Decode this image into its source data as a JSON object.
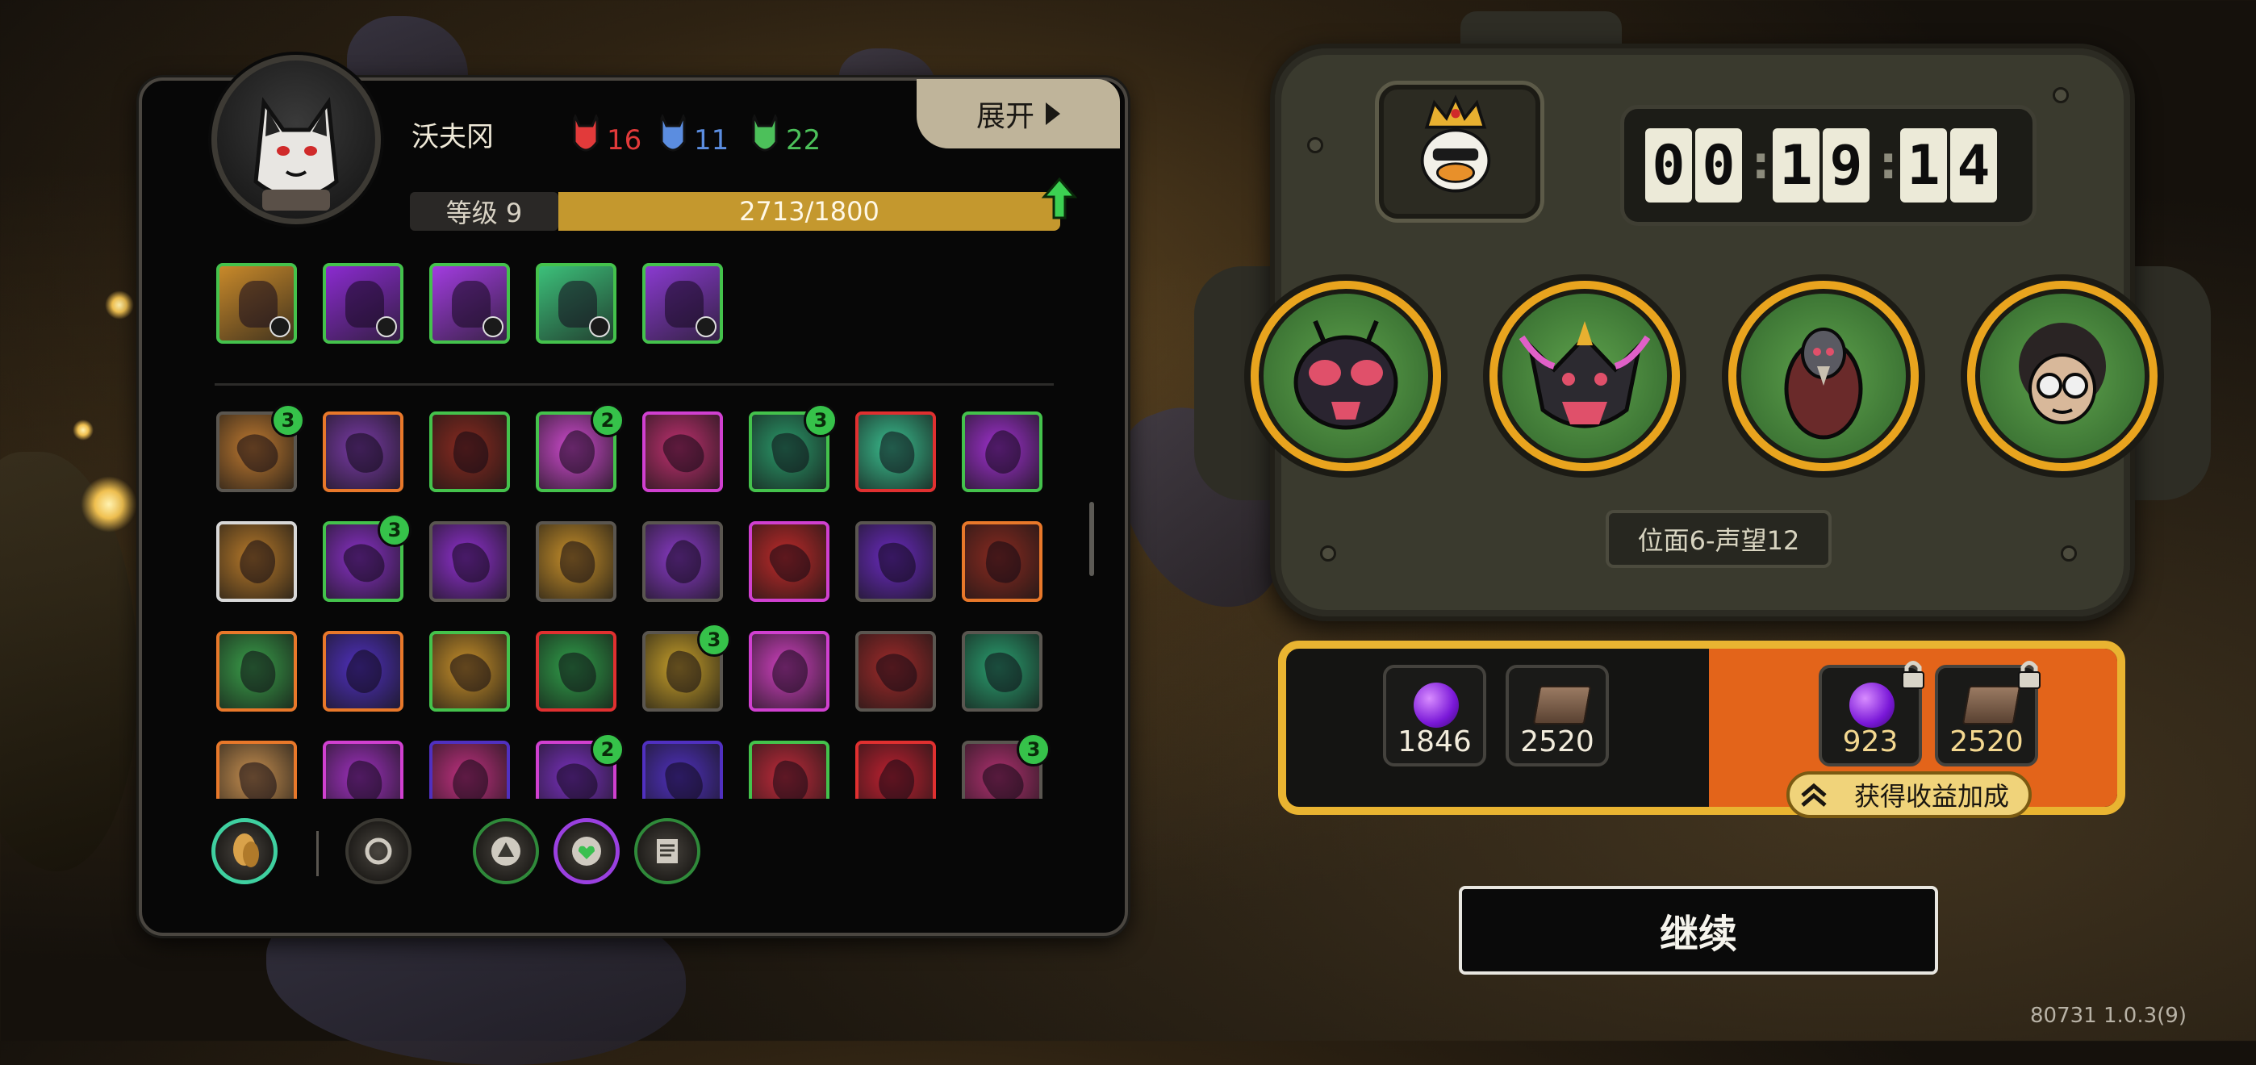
{
  "player": {
    "name": "沃夫冈",
    "level_label": "等级 9",
    "xp_text": "2713/1800",
    "stats": [
      {
        "icon": "red-mask-icon",
        "value": "16",
        "color": "#e23a3a"
      },
      {
        "icon": "blue-mask-icon",
        "value": "11",
        "color": "#5b8de0"
      },
      {
        "icon": "green-mask-icon",
        "value": "22",
        "color": "#4cc05a"
      }
    ]
  },
  "expand_label": "展开",
  "timer": {
    "h1": "0",
    "h2": "0",
    "m1": "1",
    "m2": "9",
    "s1": "1",
    "s2": "4"
  },
  "plane_label": "位面6-声望12",
  "rewards": {
    "left": [
      {
        "icon": "purple-orb-icon",
        "value": "1846"
      },
      {
        "icon": "tome-icon",
        "value": "2520"
      }
    ],
    "right": [
      {
        "icon": "purple-orb-icon",
        "value": "923"
      },
      {
        "icon": "tome-icon",
        "value": "2520"
      }
    ],
    "bonus_label": "获得收益加成"
  },
  "continue_label": "继续",
  "version": "80731 1.0.3(9)",
  "equipped_skills": [
    {
      "color": "#c8892a",
      "border": "#44c24c"
    },
    {
      "color": "#8b2bd0",
      "border": "#44c24c"
    },
    {
      "color": "#a23ce0",
      "border": "#44c24c"
    },
    {
      "color": "#3cc07a",
      "border": "#44c24c"
    },
    {
      "color": "#8a3ad0",
      "border": "#44c24c"
    }
  ],
  "relics": [
    [
      {
        "c": "#c07a30",
        "b": "#5a5650",
        "n": "3"
      },
      {
        "c": "#7a3aa8",
        "b": "#e8782a"
      },
      {
        "c": "#8a2a20",
        "b": "#44c24c"
      },
      {
        "c": "#d04ad0",
        "b": "#44c24c",
        "n": "2"
      },
      {
        "c": "#c03070",
        "b": "#d040d0"
      },
      {
        "c": "#2a9a6a",
        "b": "#44c24c",
        "n": "3"
      },
      {
        "c": "#3ac090",
        "b": "#e03030"
      },
      {
        "c": "#a030d0",
        "b": "#44c24c"
      }
    ],
    [
      {
        "c": "#b87a2a",
        "b": "#d8d8d8"
      },
      {
        "c": "#8a30c8",
        "b": "#44c24c",
        "n": "3"
      },
      {
        "c": "#9030d0",
        "b": "#5a5650"
      },
      {
        "c": "#c8902a",
        "b": "#5a5650"
      },
      {
        "c": "#8a3ac8",
        "b": "#5a5650"
      },
      {
        "c": "#c02a2a",
        "b": "#d040d0"
      },
      {
        "c": "#6a2ac0",
        "b": "#5a5650"
      },
      {
        "c": "#8a2a20",
        "b": "#e8782a"
      }
    ],
    [
      {
        "c": "#3aa04a",
        "b": "#e8782a"
      },
      {
        "c": "#5030c0",
        "b": "#e8782a"
      },
      {
        "c": "#c8902a",
        "b": "#44c24c"
      },
      {
        "c": "#30a04a",
        "b": "#e03030"
      },
      {
        "c": "#c8a02a",
        "b": "#5a5650",
        "n": "3"
      },
      {
        "c": "#d040c0",
        "b": "#d040d0"
      },
      {
        "c": "#a02a2a",
        "b": "#5a5650"
      },
      {
        "c": "#2aa070",
        "b": "#5a5650"
      }
    ],
    [
      {
        "c": "#c89050",
        "b": "#e8782a"
      },
      {
        "c": "#a030c0",
        "b": "#d040d0"
      },
      {
        "c": "#c03080",
        "b": "#5030c0"
      },
      {
        "c": "#7a30c0",
        "b": "#d040d0",
        "n": "2"
      },
      {
        "c": "#5030c0",
        "b": "#5030c0"
      },
      {
        "c": "#c02a3a",
        "b": "#44c24c"
      },
      {
        "c": "#c02030",
        "b": "#e03030"
      },
      {
        "c": "#b03070",
        "b": "#5a5650",
        "n": "3"
      }
    ]
  ],
  "enemies": [
    {
      "icon": "beetle-enemy-icon"
    },
    {
      "icon": "demon-boss-icon"
    },
    {
      "icon": "vulture-enemy-icon"
    },
    {
      "icon": "nerd-enemy-icon"
    }
  ]
}
